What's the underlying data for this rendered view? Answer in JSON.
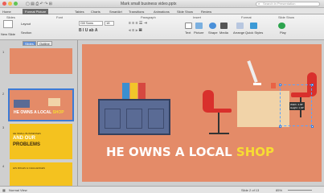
{
  "window": {
    "title": "Mark small business video.pptx",
    "search_placeholder": "Search in Presentation"
  },
  "tabs": [
    {
      "label": "Home"
    },
    {
      "label": "Format Picture"
    },
    {
      "label": "Tables"
    },
    {
      "label": "Charts"
    },
    {
      "label": "SmartArt"
    },
    {
      "label": "Transitions"
    },
    {
      "label": "Animations"
    },
    {
      "label": "Slide Show"
    },
    {
      "label": "Review"
    }
  ],
  "ribbon": {
    "sections": {
      "slides": "Slides",
      "font": "Font",
      "paragraph": "Paragraph",
      "insert": "Insert",
      "format": "Format",
      "slide_show": "Slide Show"
    },
    "new_slide": "New Slide",
    "layout": "Layout",
    "section": "Section",
    "font_name": "Gill Sans",
    "font_size": "18",
    "buttons": {
      "text": "Text",
      "picture": "Picture",
      "shape": "Shape",
      "media": "Media",
      "arrange": "Arrange",
      "quick_styles": "Quick Styles",
      "play": "Play"
    }
  },
  "sidebar": {
    "tabs": [
      "Slides",
      "Outline"
    ],
    "thumbs": [
      {
        "num": "1",
        "text": ""
      },
      {
        "num": "2",
        "title_plain": "HE OWNS A LOCAL ",
        "title_hl": "SHOP"
      },
      {
        "num": "3",
        "small": "HE SMALL BUSINESSES",
        "big": "AND OUR",
        "big2": "PROBLEMS"
      },
      {
        "num": "4",
        "text": "HIS ROLES & CHALLENGES"
      }
    ]
  },
  "slide": {
    "title_plain": "HE OWNS A LOCAL ",
    "title_hl": "SHOP",
    "tooltip_l1": "Width: 4.45\"",
    "tooltip_l2": "Height: 1.04\""
  },
  "status": {
    "view": "Normal View",
    "slide": "Slide 2 of 13",
    "zoom": "85%"
  },
  "colors": {
    "slide_bg": "#e48b68",
    "highlight": "#f7dc33",
    "thumb_yellow": "#f4c21f",
    "desk": "#5a6b95"
  }
}
